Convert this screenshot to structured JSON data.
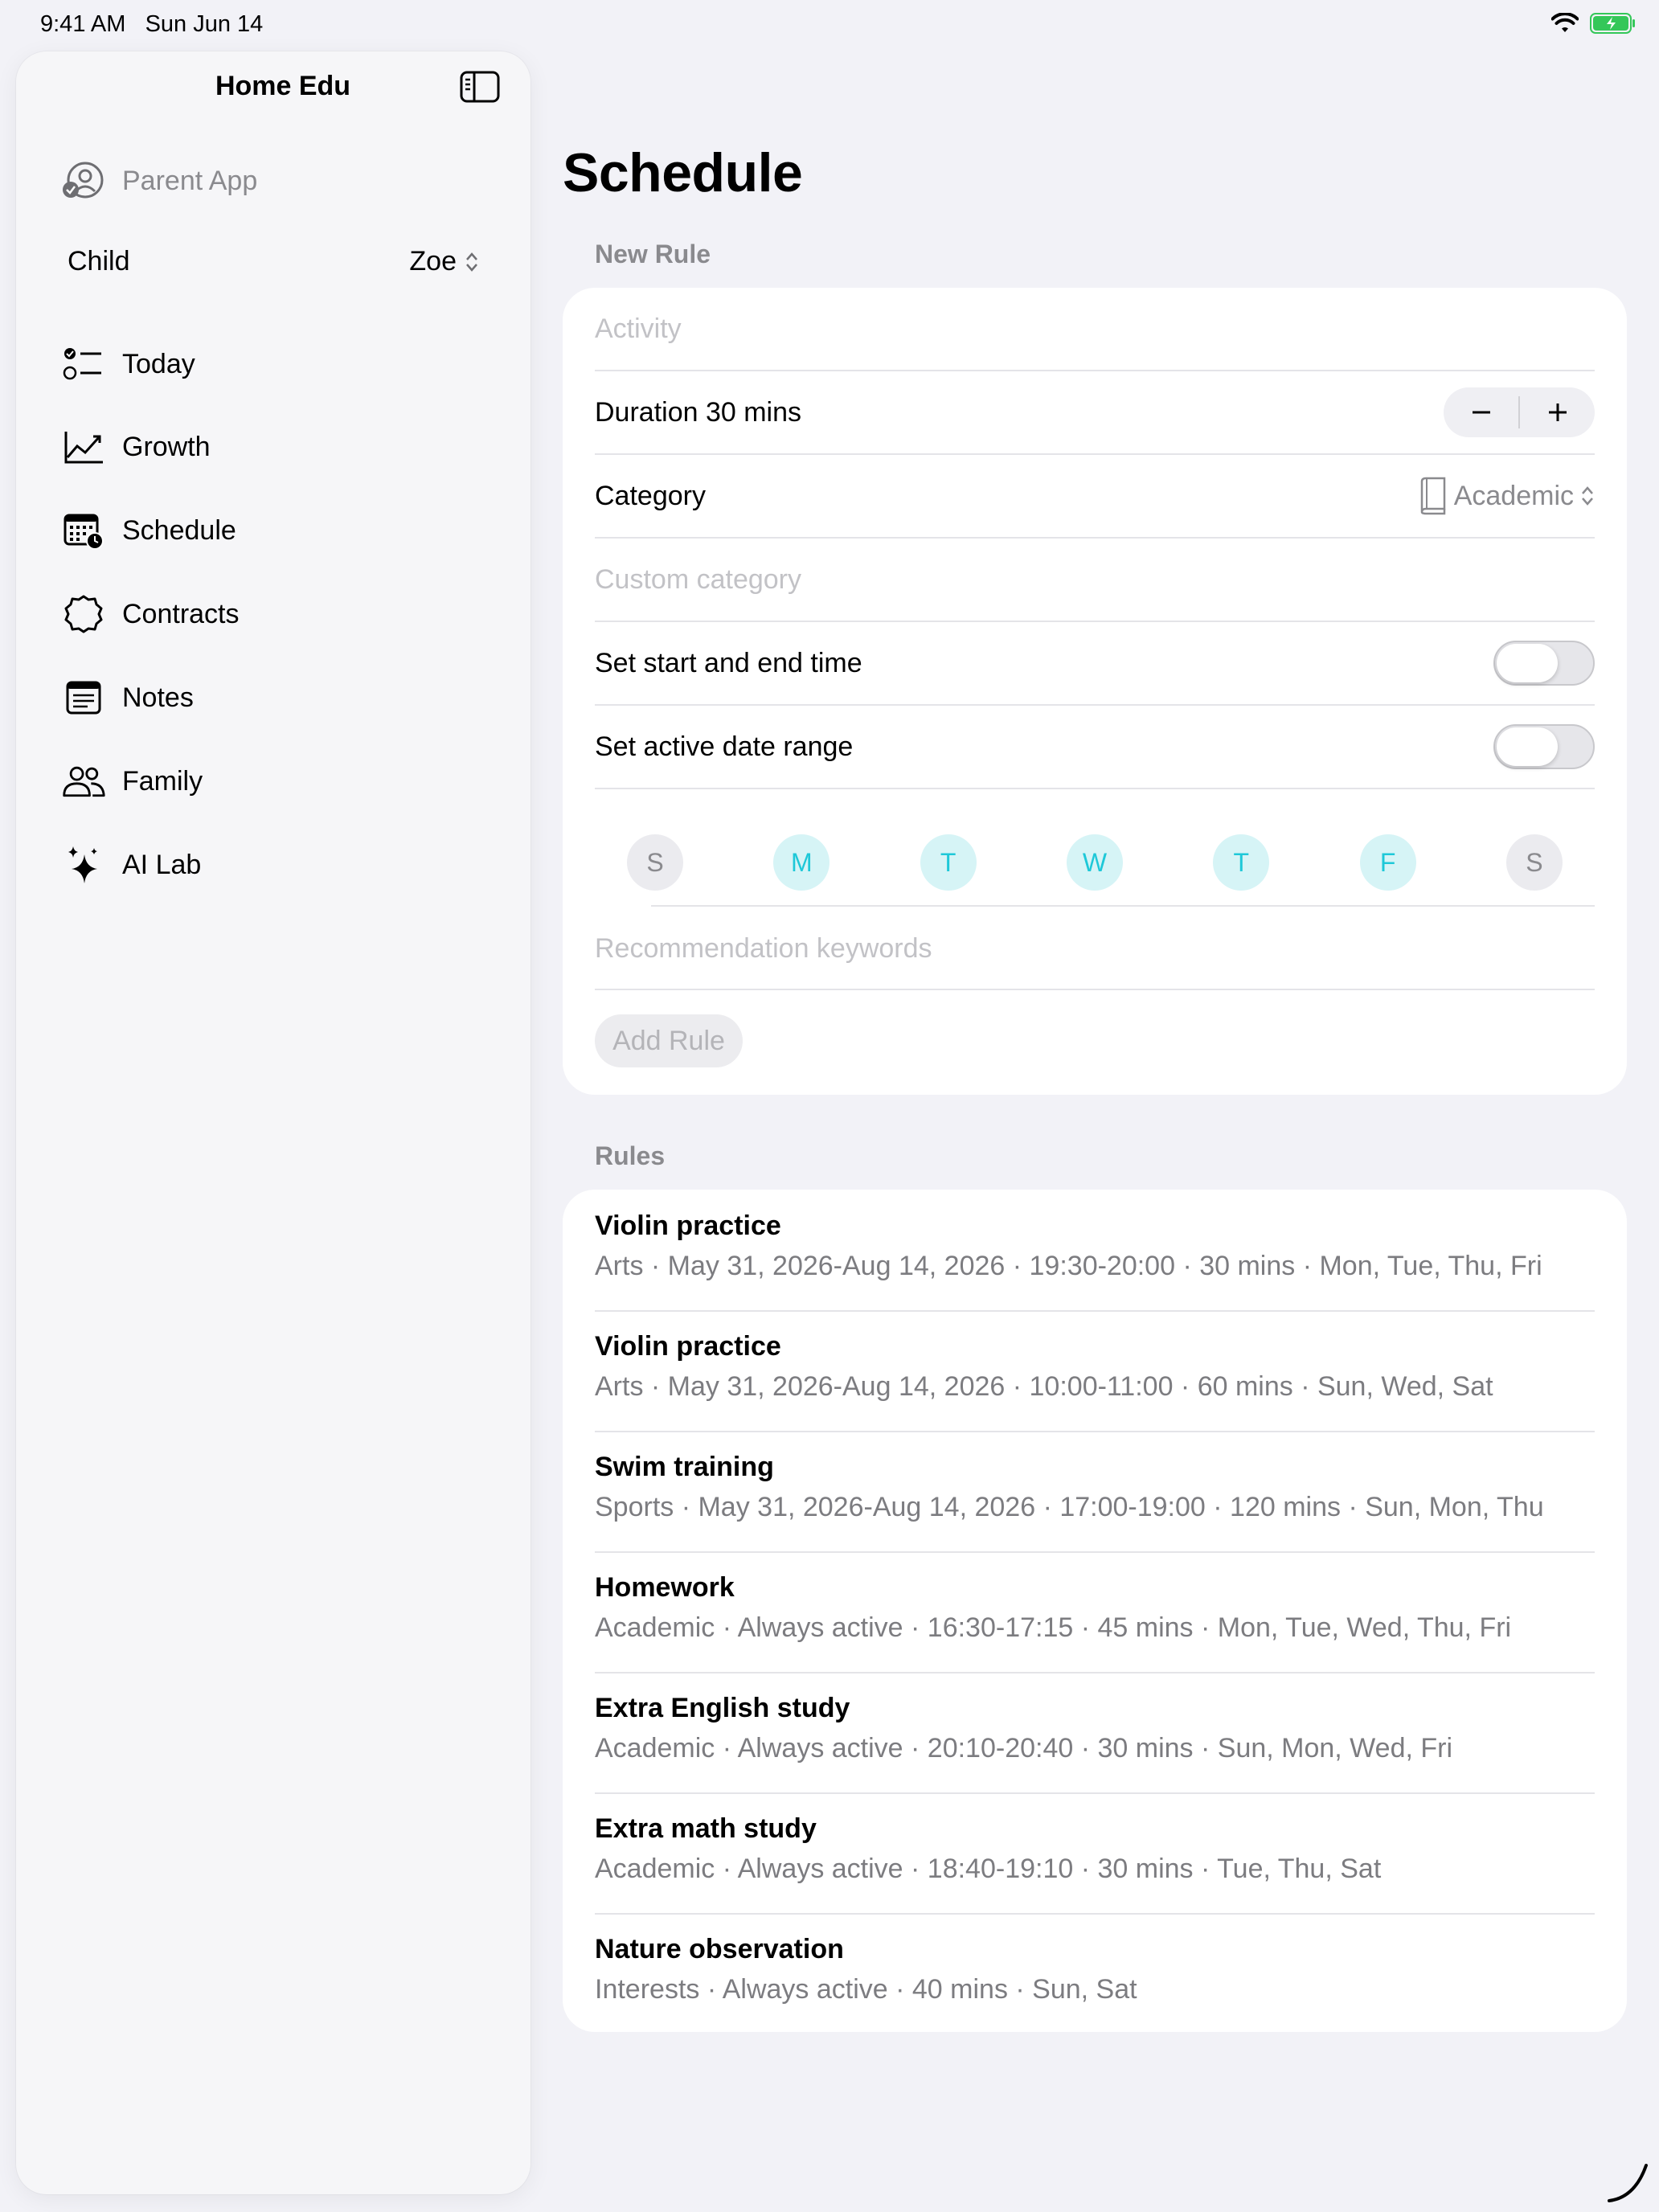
{
  "status_bar": {
    "time": "9:41 AM",
    "date": "Sun Jun 14"
  },
  "sidebar": {
    "title": "Home Edu",
    "parent_app": "Parent App",
    "child_label": "Child",
    "child_value": "Zoe",
    "items": [
      {
        "label": "Today",
        "icon": "checklist-icon"
      },
      {
        "label": "Growth",
        "icon": "chart-line-icon"
      },
      {
        "label": "Schedule",
        "icon": "calendar-clock-icon"
      },
      {
        "label": "Contracts",
        "icon": "seal-icon"
      },
      {
        "label": "Notes",
        "icon": "notes-icon"
      },
      {
        "label": "Family",
        "icon": "people-icon"
      },
      {
        "label": "AI Lab",
        "icon": "sparkles-icon"
      }
    ]
  },
  "main": {
    "title": "Schedule",
    "new_rule": {
      "header": "New Rule",
      "activity_placeholder": "Activity",
      "duration_label": "Duration 30 mins",
      "category_label": "Category",
      "category_value": "Academic",
      "custom_category_placeholder": "Custom category",
      "start_end_label": "Set start and end time",
      "start_end_on": false,
      "date_range_label": "Set active date range",
      "date_range_on": false,
      "days": [
        {
          "letter": "S",
          "selected": false
        },
        {
          "letter": "M",
          "selected": true
        },
        {
          "letter": "T",
          "selected": true
        },
        {
          "letter": "W",
          "selected": true
        },
        {
          "letter": "T",
          "selected": true
        },
        {
          "letter": "F",
          "selected": true
        },
        {
          "letter": "S",
          "selected": false
        }
      ],
      "keywords_placeholder": "Recommendation keywords",
      "add_button": "Add Rule"
    },
    "rules": {
      "header": "Rules",
      "items": [
        {
          "title": "Violin practice",
          "detail": "Arts · May 31, 2026-Aug 14, 2026 · 19:30-20:00 · 30 mins · Mon, Tue, Thu, Fri"
        },
        {
          "title": "Violin practice",
          "detail": "Arts · May 31, 2026-Aug 14, 2026 · 10:00-11:00 · 60 mins · Sun, Wed, Sat"
        },
        {
          "title": "Swim training",
          "detail": "Sports · May 31, 2026-Aug 14, 2026 · 17:00-19:00 · 120 mins · Sun, Mon, Thu"
        },
        {
          "title": "Homework",
          "detail": "Academic · Always active · 16:30-17:15 · 45 mins · Mon, Tue, Wed, Thu, Fri"
        },
        {
          "title": "Extra English study",
          "detail": "Academic · Always active · 20:10-20:40 · 30 mins · Sun, Mon, Wed, Fri"
        },
        {
          "title": "Extra math study",
          "detail": "Academic · Always active · 18:40-19:10 · 30 mins · Tue, Thu, Sat"
        },
        {
          "title": "Nature observation",
          "detail": "Interests · Always active · 40 mins · Sun, Sat"
        }
      ]
    }
  },
  "colors": {
    "accent": "#1ec8d8",
    "accent_bg": "#d6f4f6",
    "battery": "#34c759"
  }
}
